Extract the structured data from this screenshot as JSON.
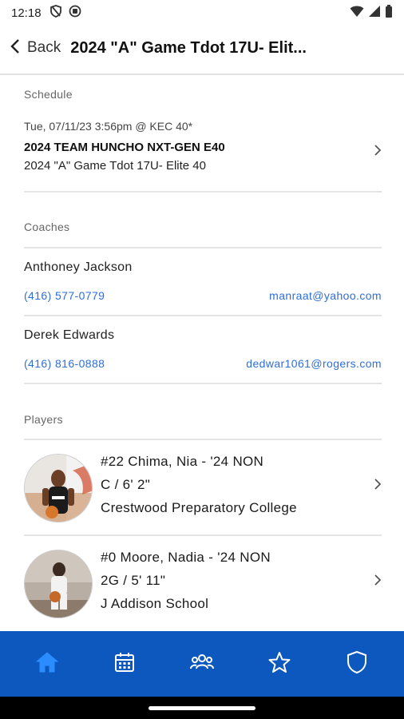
{
  "status_bar": {
    "time": "12:18"
  },
  "header": {
    "back_label": "Back",
    "title": "2024 \"A\" Game Tdot 17U- Elit..."
  },
  "schedule": {
    "section_label": "Schedule",
    "date_location": "Tue, 07/11/23 3:56pm @ KEC 40*",
    "team": "2024 TEAM HUNCHO NXT-GEN E40",
    "event": "2024 \"A\" Game Tdot 17U- Elite 40"
  },
  "coaches": {
    "section_label": "Coaches",
    "items": [
      {
        "name": "Anthoney Jackson",
        "phone": "(416) 577-0779",
        "email": "manraat@yahoo.com"
      },
      {
        "name": "Derek Edwards",
        "phone": "(416) 816-0888",
        "email": "dedwar1061@rogers.com"
      }
    ]
  },
  "players": {
    "section_label": "Players",
    "items": [
      {
        "line1": "#22 Chima, Nia - '24 NON",
        "line2": "C / 6' 2\"",
        "line3": "Crestwood Preparatory College"
      },
      {
        "line1": "#0 Moore, Nadia - '24 NON",
        "line2": "2G / 5' 11\"",
        "line3": "J Addison School"
      }
    ]
  },
  "tab_bar": {
    "active_color": "#2b8cff",
    "inactive_color": "#ffffff",
    "background": "#0d58bf",
    "tabs": [
      "home-icon",
      "calendar-icon",
      "team-icon",
      "star-icon",
      "shield-icon"
    ]
  }
}
